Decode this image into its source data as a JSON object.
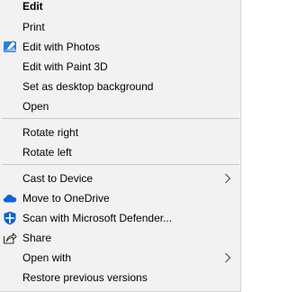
{
  "menu": {
    "items": [
      {
        "label": "Edit"
      },
      {
        "label": "Print"
      },
      {
        "label": "Edit with Photos",
        "icon": "photos-icon"
      },
      {
        "label": "Edit with Paint 3D"
      },
      {
        "label": "Set as desktop background"
      },
      {
        "label": "Open"
      },
      {
        "label": "Rotate right"
      },
      {
        "label": "Rotate left"
      },
      {
        "label": "Cast to Device",
        "submenu": true
      },
      {
        "label": "Move to OneDrive",
        "icon": "onedrive-icon"
      },
      {
        "label": "Scan with Microsoft Defender...",
        "icon": "defender-icon"
      },
      {
        "label": "Share",
        "icon": "share-icon"
      },
      {
        "label": "Open with",
        "submenu": true
      },
      {
        "label": "Restore previous versions"
      }
    ]
  },
  "colors": {
    "background": "#f2f2f2",
    "separator": "#c7c7c7",
    "onedrive": "#0a64d8",
    "defender": "#0a62c6",
    "photos": "#2f7de1"
  }
}
